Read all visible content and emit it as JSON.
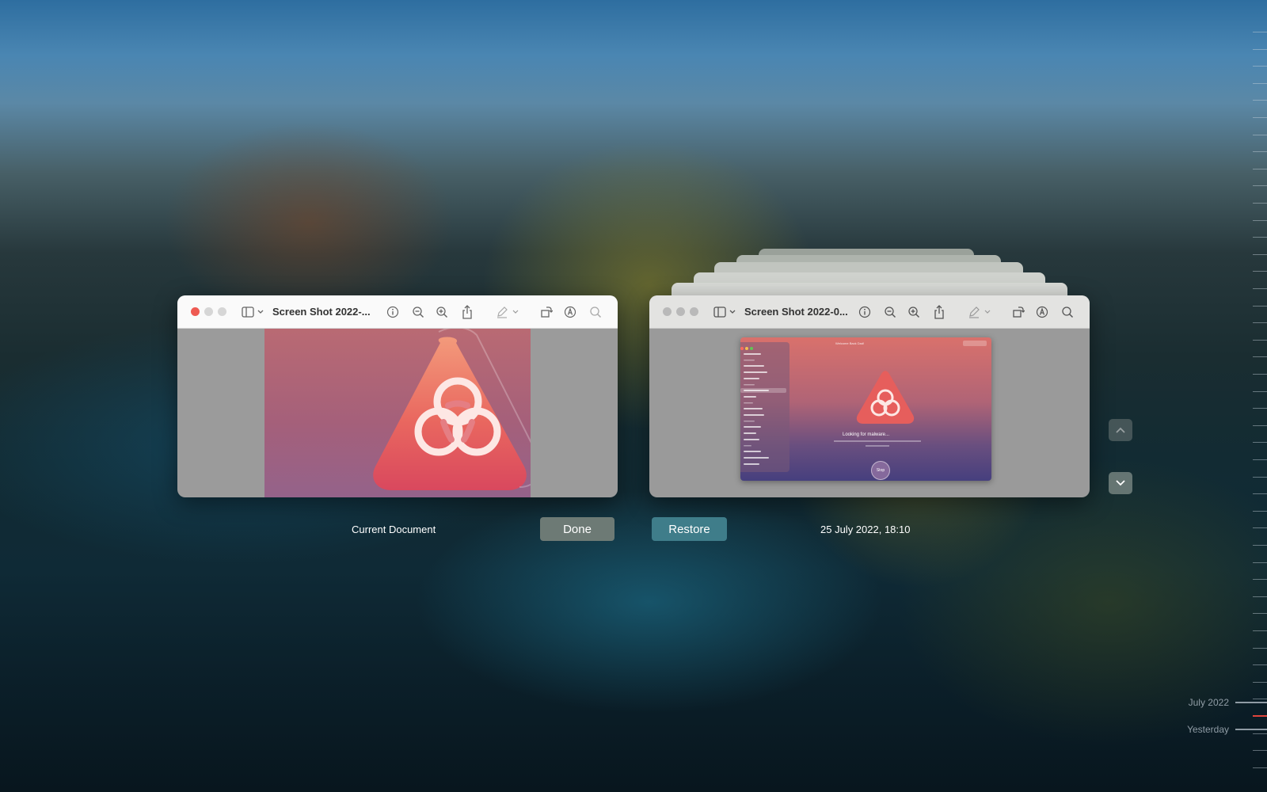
{
  "current_window": {
    "title": "Screen Shot 2022-...",
    "image_description": "biohazard-warning"
  },
  "version_window": {
    "title": "Screen Shot 2022-0...",
    "thumb": {
      "header_title": "Welcome Back Dad!",
      "status_text": "Looking for malware...",
      "stop_label": "Stop"
    }
  },
  "labels": {
    "current": "Current Document",
    "version_date": "25 July 2022, 18:10"
  },
  "buttons": {
    "done": "Done",
    "restore": "Restore"
  },
  "timeline": {
    "items": [
      {
        "label": "July 2022"
      },
      {
        "label": "Yesterday"
      }
    ]
  },
  "colors": {
    "accent_red": "#e0443c",
    "restore_button": "#3f7d8a",
    "done_button": "#6d7a75"
  }
}
